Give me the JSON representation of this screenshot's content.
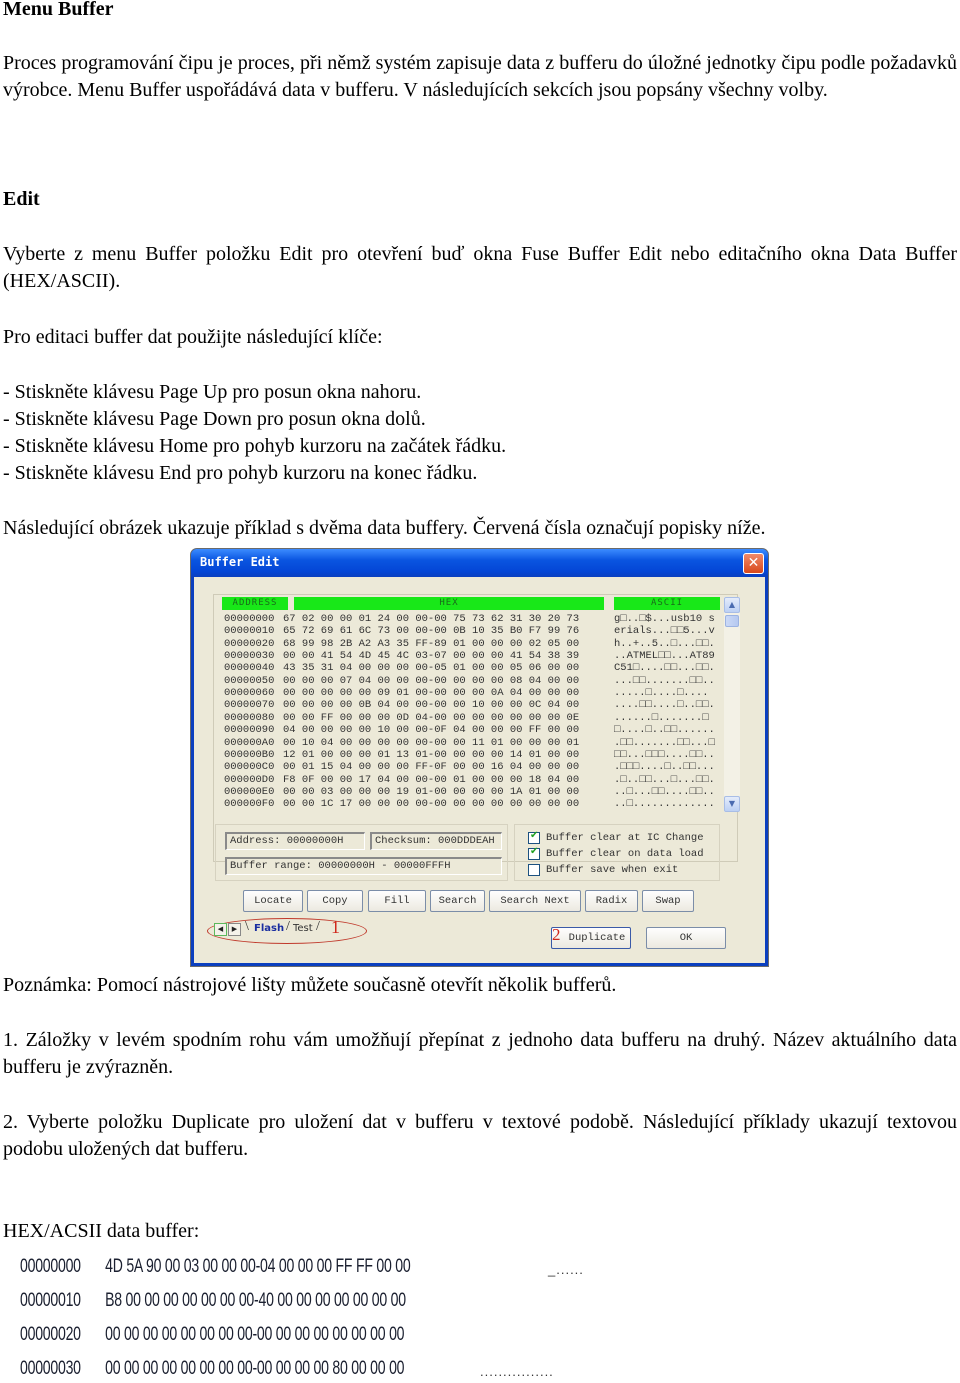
{
  "doc": {
    "title": "Menu Buffer",
    "intro": "Proces programování čipu je proces, při němž systém zapisuje data z bufferu do úložné jednotky čipu podle požadavků výrobce. Menu Buffer uspořádává data v bufferu. V následujících sekcích jsou popsány všechny volby.",
    "edit_heading": "Edit",
    "edit_para": "Vyberte z menu Buffer položku Edit pro otevření buď okna Fuse Buffer Edit nebo editačního okna Data Buffer (HEX/ASCII).",
    "keys_intro": "Pro editaci buffer dat použijte následující klíče:",
    "keys": [
      "- Stiskněte klávesu Page Up pro posun okna nahoru.",
      "- Stiskněte klávesu Page Down pro posun okna dolů.",
      "- Stiskněte klávesu Home pro pohyb kurzoru na začátek řádku.",
      "- Stiskněte klávesu End pro pohyb kurzoru na konec řádku."
    ],
    "figure_intro": "Následující obrázek ukazuje příklad s dvěma data buffery. Červená čísla označují popisky níže.",
    "note": "Poznámka: Pomocí nástrojové lišty můžete současně otevřít několik bufferů.",
    "item1": "1. Záložky v levém spodním rohu vám umožňují přepínat z jednoho data bufferu na druhý. Název aktuálního data bufferu je zvýrazněn.",
    "item2": "2. Vyberte položku Duplicate pro uložení dat v bufferu v textové podobě. Následující příklady ukazují textovou podobu uložených dat bufferu.",
    "hex_heading": "HEX/ACSII data buffer:"
  },
  "window": {
    "title": "Buffer Edit",
    "close_icon": "close-icon",
    "columns": [
      "ADDRESS",
      "HEX",
      "ASCII"
    ],
    "rows": [
      {
        "addr": "00000000",
        "hex": "67 02 00 00 01 24 00 00-00 75 73 62 31 30 20 73",
        "ascii": "g□..□$...usb10 s"
      },
      {
        "addr": "00000010",
        "hex": "65 72 69 61 6C 73 00 00-00 0B 10 35 B0 F7 99 76",
        "ascii": "erials...□□5...v"
      },
      {
        "addr": "00000020",
        "hex": "68 99 98 2B A2 A3 35 FF-89 01 00 00 00 02 05 00",
        "ascii": "h..+..5..□...□□."
      },
      {
        "addr": "00000030",
        "hex": "00 00 41 54 4D 45 4C 03-07 00 00 00 41 54 38 39",
        "ascii": "..ATMEL□□...AT89"
      },
      {
        "addr": "00000040",
        "hex": "43 35 31 04 00 00 00 00-05 01 00 00 05 06 00 00",
        "ascii": "C51□....□□...□□."
      },
      {
        "addr": "00000050",
        "hex": "00 00 00 07 04 00 00 00-00 00 00 00 08 04 00 00",
        "ascii": "...□□.......□□.."
      },
      {
        "addr": "00000060",
        "hex": "00 00 00 00 00 09 01 00-00 00 00 0A 04 00 00 00",
        "ascii": ".....□....□...."
      },
      {
        "addr": "00000070",
        "hex": "00 00 00 00 0B 04 00 00-00 00 10 00 00 0C 04 00",
        "ascii": "....□□....□..□□."
      },
      {
        "addr": "00000080",
        "hex": "00 00 FF 00 00 00 0D 04-00 00 00 00 00 00 00 0E",
        "ascii": "......□.......□"
      },
      {
        "addr": "00000090",
        "hex": "04 00 00 00 00 10 00 00-0F 04 00 00 00 FF 00 00",
        "ascii": "□....□..□□......"
      },
      {
        "addr": "000000A0",
        "hex": "00 10 04 00 00 00 00 00-00 00 11 01 00 00 00 01",
        "ascii": ".□□.......□□...□"
      },
      {
        "addr": "000000B0",
        "hex": "12 01 00 00 00 01 13 01-00 00 00 00 14 01 00 00",
        "ascii": "□□...□□□....□□.."
      },
      {
        "addr": "000000C0",
        "hex": "00 01 15 04 00 00 00 FF-0F 00 00 16 04 00 00 00",
        "ascii": ".□□□....□..□□..."
      },
      {
        "addr": "000000D0",
        "hex": "F8 0F 00 00 17 04 00 00-00 01 00 00 00 18 04 00",
        "ascii": ".□..□□...□...□□."
      },
      {
        "addr": "000000E0",
        "hex": "00 00 03 00 00 00 19 01-00 00 00 00 1A 01 00 00",
        "ascii": "..□...□□....□□.."
      },
      {
        "addr": "000000F0",
        "hex": "00 00 1C 17 00 00 00 00-00 00 00 00 00 00 00 00",
        "ascii": "..□............."
      }
    ],
    "address_field": "Address: 00000000H",
    "checksum_field": "Checksum: 000DDDEAH",
    "range_field": "Buffer range: 00000000H - 00000FFFH",
    "options": [
      {
        "label": "Buffer clear at IC Change",
        "checked": true
      },
      {
        "label": "Buffer clear on data load",
        "checked": true
      },
      {
        "label": "Buffer save when exit",
        "checked": false
      }
    ],
    "buttons": [
      "Locate",
      "Copy",
      "Fill",
      "Search",
      "Search Next",
      "Radix",
      "Swap"
    ],
    "tabs": [
      {
        "label": "Flash",
        "active": true
      },
      {
        "label": "Test",
        "active": false
      }
    ],
    "tab_prev_icon": "chevron-left-icon",
    "tab_next_icon": "chevron-right-icon",
    "duplicate_label": "Duplicate",
    "ok_label": "OK",
    "callout_1": "1",
    "callout_2": "2",
    "accent_header": "#18e818",
    "accent_callout": "#d0281c"
  },
  "hex_dump": {
    "rows": [
      {
        "addr": "00000000",
        "hex": "4D 5A 90 00 03 00 00 00-04 00 00 00 FF FF 00 00",
        "ascii": "_......"
      },
      {
        "addr": "00000010",
        "hex": "B8 00 00 00 00 00 00 00-40 00 00 00 00 00 00 00",
        "ascii": ""
      },
      {
        "addr": "00000020",
        "hex": "00 00 00 00 00 00 00 00-00 00 00 00 00 00 00 00",
        "ascii": ""
      },
      {
        "addr": "00000030",
        "hex": "00 00 00 00 00 00 00 00-00 00 00 00 80 00 00 00",
        "ascii": "................"
      }
    ]
  }
}
